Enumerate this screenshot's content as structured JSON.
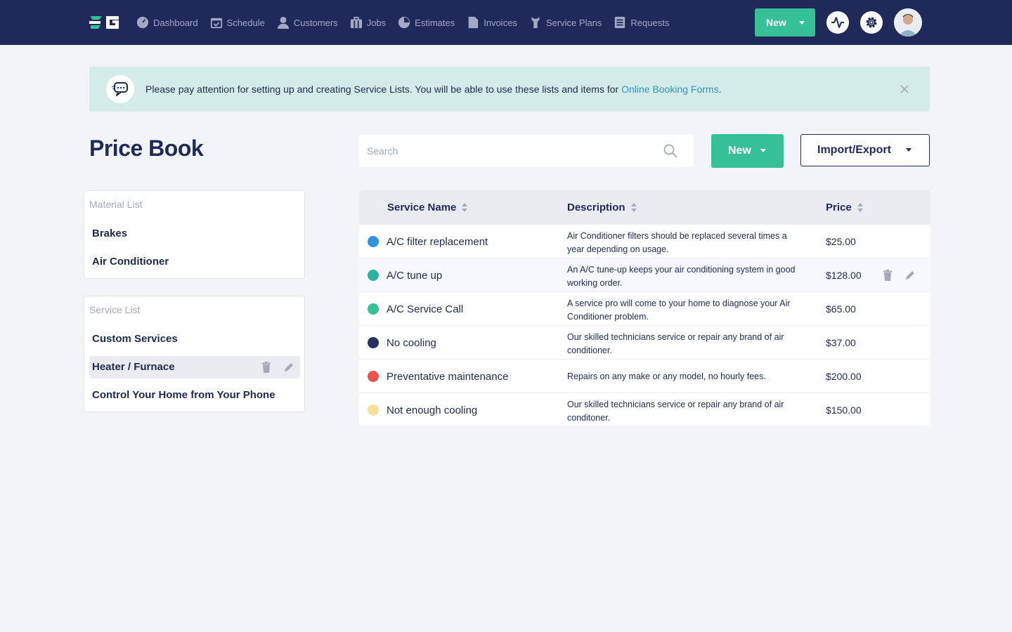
{
  "nav": {
    "items": [
      {
        "label": "Dashboard",
        "icon": "dashboard-icon"
      },
      {
        "label": "Schedule",
        "icon": "calendar-icon"
      },
      {
        "label": "Customers",
        "icon": "user-icon"
      },
      {
        "label": "Jobs",
        "icon": "briefcase-icon"
      },
      {
        "label": "Estimates",
        "icon": "estimate-icon"
      },
      {
        "label": "Invoices",
        "icon": "document-icon"
      },
      {
        "label": "Service Plans",
        "icon": "wrench-icon"
      },
      {
        "label": "Requests",
        "icon": "list-icon"
      }
    ],
    "new_label": "New"
  },
  "banner": {
    "text": "Please pay attention for setting up and creating Service Lists. You will be able to use these lists and items for ",
    "link": "Online Booking Forms",
    "suffix": "."
  },
  "page": {
    "title": "Price Book",
    "search_placeholder": "Search",
    "new_label": "New",
    "import_export_label": "Import/Export"
  },
  "material_list": {
    "heading": "Material List",
    "items": [
      "Brakes",
      "Air Conditioner"
    ]
  },
  "service_list": {
    "heading": "Service List",
    "items": [
      "Custom Services",
      "Heater / Furnace",
      "Control Your Home from Your Phone"
    ],
    "active_index": 1
  },
  "table": {
    "columns": [
      "Service Name",
      "Description",
      "Price"
    ],
    "rows": [
      {
        "color": "#2f93dd",
        "name": "A/C filter replacement",
        "desc": "Air Conditioner filters should be replaced several times a year depending on usage.",
        "price": "$25.00"
      },
      {
        "color": "#2cb3a4",
        "name": "A/C tune up",
        "desc": "An A/C tune-up keeps your air conditioning system in good working order.",
        "price": "$128.00"
      },
      {
        "color": "#36c095",
        "name": "A/C Service Call",
        "desc": "A service pro will come to your home to diagnose your Air Conditioner problem.",
        "price": "$65.00"
      },
      {
        "color": "#25305c",
        "name": "No cooling",
        "desc": "Our skilled technicians service or repair any brand of air conditioner.",
        "price": "$37.00"
      },
      {
        "color": "#e8534f",
        "name": "Preventative maintenance",
        "desc": "Repairs on any make or any model, no hourly fees.",
        "price": "$200.00"
      },
      {
        "color": "#f8e095",
        "name": "Not enough cooling",
        "desc": "Our skilled technicians service or repair any brand of air conditoner.",
        "price": "$150.00"
      }
    ],
    "hover_row": 1
  }
}
